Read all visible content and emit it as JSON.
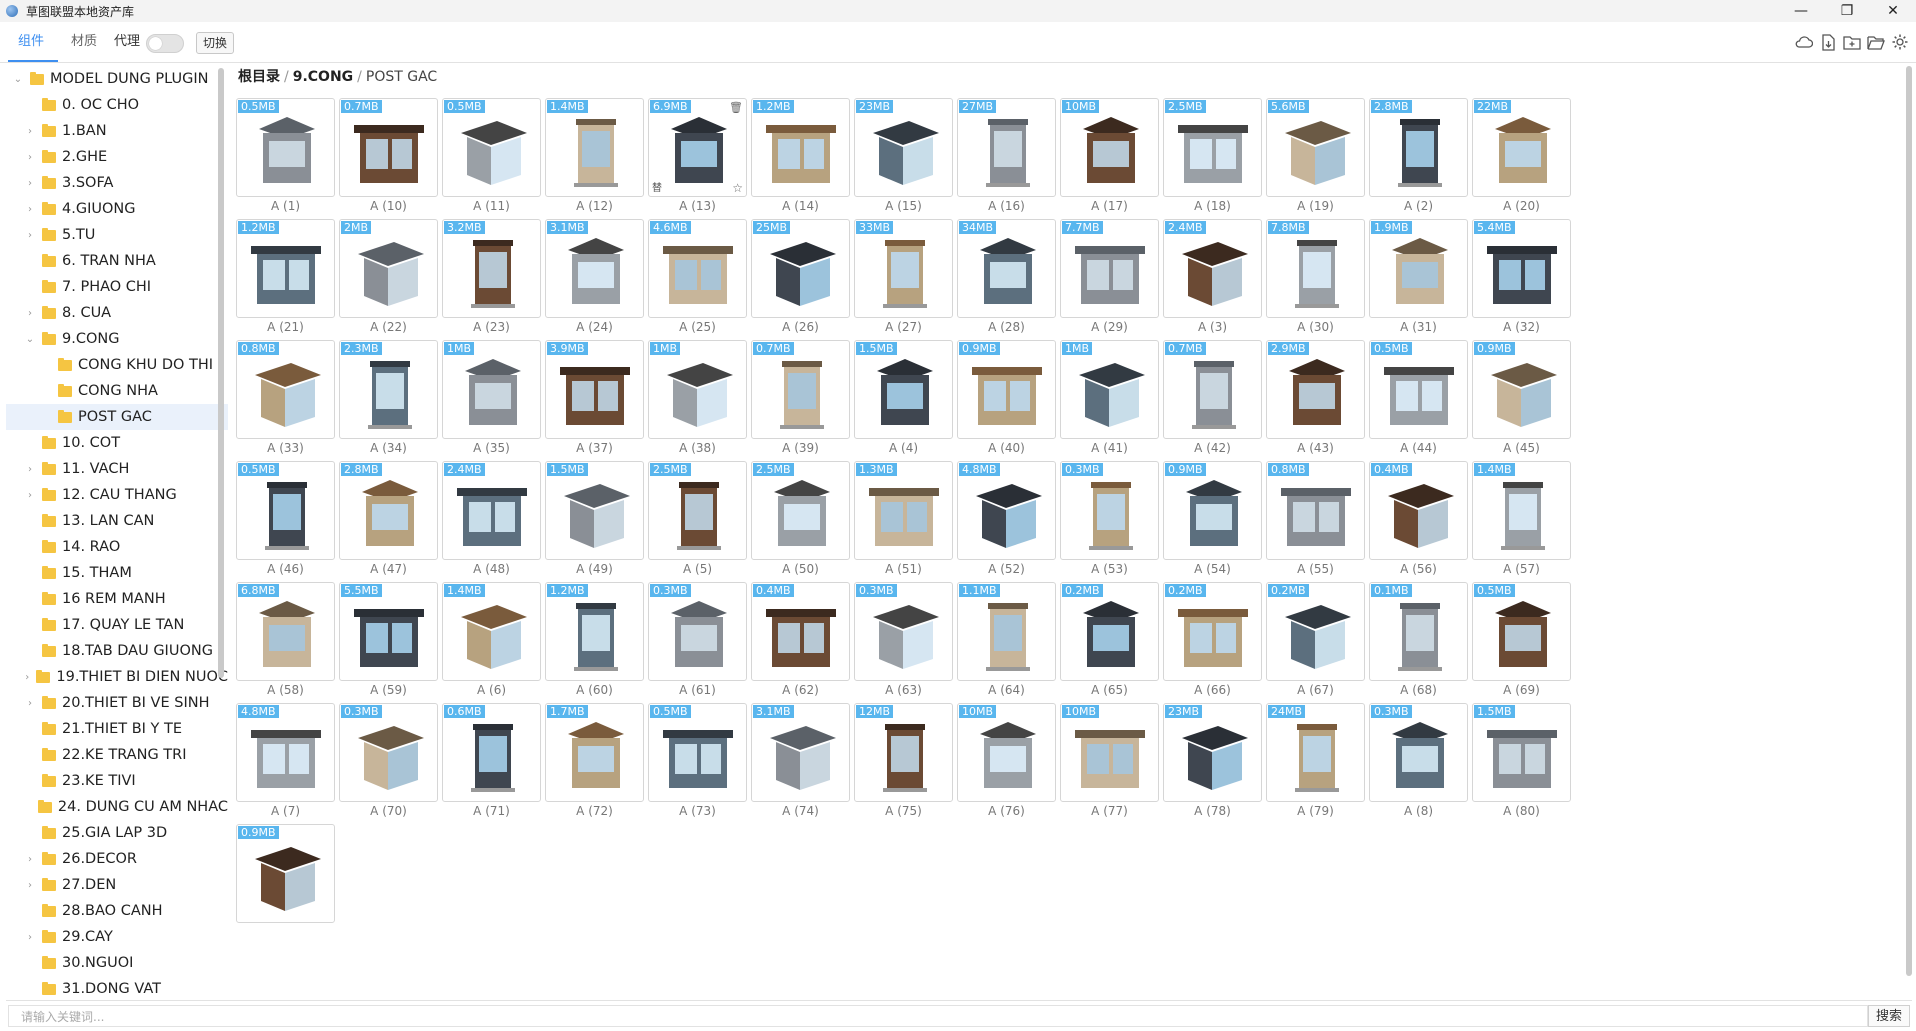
{
  "window": {
    "title": "草图联盟本地资产库",
    "minimize": "—",
    "maximize": "❐",
    "close": "✕"
  },
  "toolbar": {
    "tabs": [
      "组件",
      "材质"
    ],
    "proxy_label": "代理",
    "switch_label": "切换",
    "icons": [
      "cloud-icon",
      "import-file-icon",
      "add-folder-icon",
      "open-folder-icon",
      "settings-icon"
    ]
  },
  "breadcrumb": {
    "root": "根目录",
    "parent": "9.CONG",
    "current": "POST GAC"
  },
  "sidebar": {
    "root": "MODEL DUNG PLUGIN",
    "items": [
      {
        "label": "0. OC CHO",
        "level": 1,
        "caret": false
      },
      {
        "label": "1.BAN",
        "level": 1,
        "caret": true
      },
      {
        "label": "2.GHE",
        "level": 1,
        "caret": true
      },
      {
        "label": "3.SOFA",
        "level": 1,
        "caret": true
      },
      {
        "label": "4.GIUONG",
        "level": 1,
        "caret": true
      },
      {
        "label": "5.TU",
        "level": 1,
        "caret": true
      },
      {
        "label": "6. TRAN NHA",
        "level": 1,
        "caret": false
      },
      {
        "label": "7. PHAO CHI",
        "level": 1,
        "caret": false
      },
      {
        "label": "8. CUA",
        "level": 1,
        "caret": true
      },
      {
        "label": "9.CONG",
        "level": 1,
        "caret": true,
        "open": true
      },
      {
        "label": "CONG KHU DO THI",
        "level": 2,
        "caret": false
      },
      {
        "label": "CONG NHA",
        "level": 2,
        "caret": false
      },
      {
        "label": "POST GAC",
        "level": 2,
        "caret": false,
        "selected": true
      },
      {
        "label": "10. COT",
        "level": 1,
        "caret": false
      },
      {
        "label": "11. VACH",
        "level": 1,
        "caret": true
      },
      {
        "label": "12. CAU THANG",
        "level": 1,
        "caret": true
      },
      {
        "label": "13. LAN CAN",
        "level": 1,
        "caret": false
      },
      {
        "label": "14. RAO",
        "level": 1,
        "caret": false
      },
      {
        "label": "15. THAM",
        "level": 1,
        "caret": false
      },
      {
        "label": "16 REM MANH",
        "level": 1,
        "caret": false
      },
      {
        "label": "17. QUAY LE TAN",
        "level": 1,
        "caret": false
      },
      {
        "label": "18.TAB DAU GIUONG",
        "level": 1,
        "caret": false
      },
      {
        "label": "19.THIET BI DIEN NUOC",
        "level": 1,
        "caret": true
      },
      {
        "label": "20.THIET BI VE SINH",
        "level": 1,
        "caret": true
      },
      {
        "label": "21.THIET BI Y TE",
        "level": 1,
        "caret": false
      },
      {
        "label": "22.KE TRANG TRI",
        "level": 1,
        "caret": false
      },
      {
        "label": "23.KE TIVI",
        "level": 1,
        "caret": false
      },
      {
        "label": "24. DUNG CU AM NHAC",
        "level": 1,
        "caret": false
      },
      {
        "label": "25.GIA LAP 3D",
        "level": 1,
        "caret": false
      },
      {
        "label": "26.DECOR",
        "level": 1,
        "caret": true
      },
      {
        "label": "27.DEN",
        "level": 1,
        "caret": true
      },
      {
        "label": "28.BAO CANH",
        "level": 1,
        "caret": false
      },
      {
        "label": "29.CAY",
        "level": 1,
        "caret": true
      },
      {
        "label": "30.NGUOI",
        "level": 1,
        "caret": false
      },
      {
        "label": "31.DONG VAT",
        "level": 1,
        "caret": false
      }
    ]
  },
  "assets": [
    {
      "name": "A (1)",
      "size": "0.5MB"
    },
    {
      "name": "A (10)",
      "size": "0.7MB"
    },
    {
      "name": "A (11)",
      "size": "0.5MB"
    },
    {
      "name": "A (12)",
      "size": "1.4MB"
    },
    {
      "name": "A (13)",
      "size": "6.9MB",
      "hover": true,
      "replace": "替"
    },
    {
      "name": "A (14)",
      "size": "1.2MB"
    },
    {
      "name": "A (15)",
      "size": "23MB"
    },
    {
      "name": "A (16)",
      "size": "27MB"
    },
    {
      "name": "A (17)",
      "size": "10MB"
    },
    {
      "name": "A (18)",
      "size": "2.5MB"
    },
    {
      "name": "A (19)",
      "size": "5.6MB"
    },
    {
      "name": "A (2)",
      "size": "2.8MB"
    },
    {
      "name": "A (20)",
      "size": "22MB"
    },
    {
      "name": "A (21)",
      "size": "1.2MB"
    },
    {
      "name": "A (22)",
      "size": "2MB"
    },
    {
      "name": "A (23)",
      "size": "3.2MB"
    },
    {
      "name": "A (24)",
      "size": "3.1MB"
    },
    {
      "name": "A (25)",
      "size": "4.6MB"
    },
    {
      "name": "A (26)",
      "size": "25MB"
    },
    {
      "name": "A (27)",
      "size": "33MB"
    },
    {
      "name": "A (28)",
      "size": "34MB"
    },
    {
      "name": "A (29)",
      "size": "7.7MB"
    },
    {
      "name": "A (3)",
      "size": "2.4MB"
    },
    {
      "name": "A (30)",
      "size": "7.8MB"
    },
    {
      "name": "A (31)",
      "size": "1.9MB"
    },
    {
      "name": "A (32)",
      "size": "5.4MB"
    },
    {
      "name": "A (33)",
      "size": "0.8MB"
    },
    {
      "name": "A (34)",
      "size": "2.3MB"
    },
    {
      "name": "A (35)",
      "size": "1MB"
    },
    {
      "name": "A (37)",
      "size": "3.9MB"
    },
    {
      "name": "A (38)",
      "size": "1MB"
    },
    {
      "name": "A (39)",
      "size": "0.7MB"
    },
    {
      "name": "A (4)",
      "size": "1.5MB"
    },
    {
      "name": "A (40)",
      "size": "0.9MB"
    },
    {
      "name": "A (41)",
      "size": "1MB"
    },
    {
      "name": "A (42)",
      "size": "0.7MB"
    },
    {
      "name": "A (43)",
      "size": "2.9MB"
    },
    {
      "name": "A (44)",
      "size": "0.5MB"
    },
    {
      "name": "A (45)",
      "size": "0.9MB"
    },
    {
      "name": "A (46)",
      "size": "0.5MB"
    },
    {
      "name": "A (47)",
      "size": "2.8MB"
    },
    {
      "name": "A (48)",
      "size": "2.4MB"
    },
    {
      "name": "A (49)",
      "size": "1.5MB"
    },
    {
      "name": "A (5)",
      "size": "2.5MB"
    },
    {
      "name": "A (50)",
      "size": "2.5MB"
    },
    {
      "name": "A (51)",
      "size": "1.3MB"
    },
    {
      "name": "A (52)",
      "size": "4.8MB"
    },
    {
      "name": "A (53)",
      "size": "0.3MB"
    },
    {
      "name": "A (54)",
      "size": "0.9MB"
    },
    {
      "name": "A (55)",
      "size": "0.8MB"
    },
    {
      "name": "A (56)",
      "size": "0.4MB"
    },
    {
      "name": "A (57)",
      "size": "1.4MB"
    },
    {
      "name": "A (58)",
      "size": "6.8MB"
    },
    {
      "name": "A (59)",
      "size": "5.5MB"
    },
    {
      "name": "A (6)",
      "size": "1.4MB"
    },
    {
      "name": "A (60)",
      "size": "1.2MB"
    },
    {
      "name": "A (61)",
      "size": "0.3MB"
    },
    {
      "name": "A (62)",
      "size": "0.4MB"
    },
    {
      "name": "A (63)",
      "size": "0.3MB"
    },
    {
      "name": "A (64)",
      "size": "1.1MB"
    },
    {
      "name": "A (65)",
      "size": "0.2MB"
    },
    {
      "name": "A (66)",
      "size": "0.2MB"
    },
    {
      "name": "A (67)",
      "size": "0.2MB"
    },
    {
      "name": "A (68)",
      "size": "0.1MB"
    },
    {
      "name": "A (69)",
      "size": "0.5MB"
    },
    {
      "name": "A (7)",
      "size": "4.8MB"
    },
    {
      "name": "A (70)",
      "size": "0.3MB"
    },
    {
      "name": "A (71)",
      "size": "0.6MB"
    },
    {
      "name": "A (72)",
      "size": "1.7MB"
    },
    {
      "name": "A (73)",
      "size": "0.5MB"
    },
    {
      "name": "A (74)",
      "size": "3.1MB"
    },
    {
      "name": "A (75)",
      "size": "12MB"
    },
    {
      "name": "A (76)",
      "size": "10MB"
    },
    {
      "name": "A (77)",
      "size": "10MB"
    },
    {
      "name": "A (78)",
      "size": "23MB"
    },
    {
      "name": "A (79)",
      "size": "24MB"
    },
    {
      "name": "A (8)",
      "size": "0.3MB"
    },
    {
      "name": "A (80)",
      "size": "1.5MB"
    },
    {
      "name": "",
      "size": "0.9MB"
    }
  ],
  "search": {
    "placeholder": "请输入关键词...",
    "button": "搜索"
  },
  "colors": {
    "accent": "#3e8ff0",
    "badge": "#59b6ee",
    "folder": "#f5c542"
  }
}
